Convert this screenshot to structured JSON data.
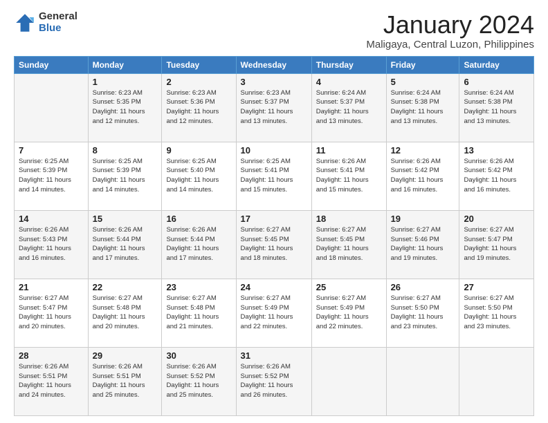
{
  "logo": {
    "general": "General",
    "blue": "Blue"
  },
  "title": {
    "month": "January 2024",
    "location": "Maligaya, Central Luzon, Philippines"
  },
  "header_days": [
    "Sunday",
    "Monday",
    "Tuesday",
    "Wednesday",
    "Thursday",
    "Friday",
    "Saturday"
  ],
  "weeks": [
    [
      {
        "day": "",
        "info": ""
      },
      {
        "day": "1",
        "info": "Sunrise: 6:23 AM\nSunset: 5:35 PM\nDaylight: 11 hours\nand 12 minutes."
      },
      {
        "day": "2",
        "info": "Sunrise: 6:23 AM\nSunset: 5:36 PM\nDaylight: 11 hours\nand 12 minutes."
      },
      {
        "day": "3",
        "info": "Sunrise: 6:23 AM\nSunset: 5:37 PM\nDaylight: 11 hours\nand 13 minutes."
      },
      {
        "day": "4",
        "info": "Sunrise: 6:24 AM\nSunset: 5:37 PM\nDaylight: 11 hours\nand 13 minutes."
      },
      {
        "day": "5",
        "info": "Sunrise: 6:24 AM\nSunset: 5:38 PM\nDaylight: 11 hours\nand 13 minutes."
      },
      {
        "day": "6",
        "info": "Sunrise: 6:24 AM\nSunset: 5:38 PM\nDaylight: 11 hours\nand 13 minutes."
      }
    ],
    [
      {
        "day": "7",
        "info": "Sunrise: 6:25 AM\nSunset: 5:39 PM\nDaylight: 11 hours\nand 14 minutes."
      },
      {
        "day": "8",
        "info": "Sunrise: 6:25 AM\nSunset: 5:39 PM\nDaylight: 11 hours\nand 14 minutes."
      },
      {
        "day": "9",
        "info": "Sunrise: 6:25 AM\nSunset: 5:40 PM\nDaylight: 11 hours\nand 14 minutes."
      },
      {
        "day": "10",
        "info": "Sunrise: 6:25 AM\nSunset: 5:41 PM\nDaylight: 11 hours\nand 15 minutes."
      },
      {
        "day": "11",
        "info": "Sunrise: 6:26 AM\nSunset: 5:41 PM\nDaylight: 11 hours\nand 15 minutes."
      },
      {
        "day": "12",
        "info": "Sunrise: 6:26 AM\nSunset: 5:42 PM\nDaylight: 11 hours\nand 16 minutes."
      },
      {
        "day": "13",
        "info": "Sunrise: 6:26 AM\nSunset: 5:42 PM\nDaylight: 11 hours\nand 16 minutes."
      }
    ],
    [
      {
        "day": "14",
        "info": "Sunrise: 6:26 AM\nSunset: 5:43 PM\nDaylight: 11 hours\nand 16 minutes."
      },
      {
        "day": "15",
        "info": "Sunrise: 6:26 AM\nSunset: 5:44 PM\nDaylight: 11 hours\nand 17 minutes."
      },
      {
        "day": "16",
        "info": "Sunrise: 6:26 AM\nSunset: 5:44 PM\nDaylight: 11 hours\nand 17 minutes."
      },
      {
        "day": "17",
        "info": "Sunrise: 6:27 AM\nSunset: 5:45 PM\nDaylight: 11 hours\nand 18 minutes."
      },
      {
        "day": "18",
        "info": "Sunrise: 6:27 AM\nSunset: 5:45 PM\nDaylight: 11 hours\nand 18 minutes."
      },
      {
        "day": "19",
        "info": "Sunrise: 6:27 AM\nSunset: 5:46 PM\nDaylight: 11 hours\nand 19 minutes."
      },
      {
        "day": "20",
        "info": "Sunrise: 6:27 AM\nSunset: 5:47 PM\nDaylight: 11 hours\nand 19 minutes."
      }
    ],
    [
      {
        "day": "21",
        "info": "Sunrise: 6:27 AM\nSunset: 5:47 PM\nDaylight: 11 hours\nand 20 minutes."
      },
      {
        "day": "22",
        "info": "Sunrise: 6:27 AM\nSunset: 5:48 PM\nDaylight: 11 hours\nand 20 minutes."
      },
      {
        "day": "23",
        "info": "Sunrise: 6:27 AM\nSunset: 5:48 PM\nDaylight: 11 hours\nand 21 minutes."
      },
      {
        "day": "24",
        "info": "Sunrise: 6:27 AM\nSunset: 5:49 PM\nDaylight: 11 hours\nand 22 minutes."
      },
      {
        "day": "25",
        "info": "Sunrise: 6:27 AM\nSunset: 5:49 PM\nDaylight: 11 hours\nand 22 minutes."
      },
      {
        "day": "26",
        "info": "Sunrise: 6:27 AM\nSunset: 5:50 PM\nDaylight: 11 hours\nand 23 minutes."
      },
      {
        "day": "27",
        "info": "Sunrise: 6:27 AM\nSunset: 5:50 PM\nDaylight: 11 hours\nand 23 minutes."
      }
    ],
    [
      {
        "day": "28",
        "info": "Sunrise: 6:26 AM\nSunset: 5:51 PM\nDaylight: 11 hours\nand 24 minutes."
      },
      {
        "day": "29",
        "info": "Sunrise: 6:26 AM\nSunset: 5:51 PM\nDaylight: 11 hours\nand 25 minutes."
      },
      {
        "day": "30",
        "info": "Sunrise: 6:26 AM\nSunset: 5:52 PM\nDaylight: 11 hours\nand 25 minutes."
      },
      {
        "day": "31",
        "info": "Sunrise: 6:26 AM\nSunset: 5:52 PM\nDaylight: 11 hours\nand 26 minutes."
      },
      {
        "day": "",
        "info": ""
      },
      {
        "day": "",
        "info": ""
      },
      {
        "day": "",
        "info": ""
      }
    ]
  ]
}
